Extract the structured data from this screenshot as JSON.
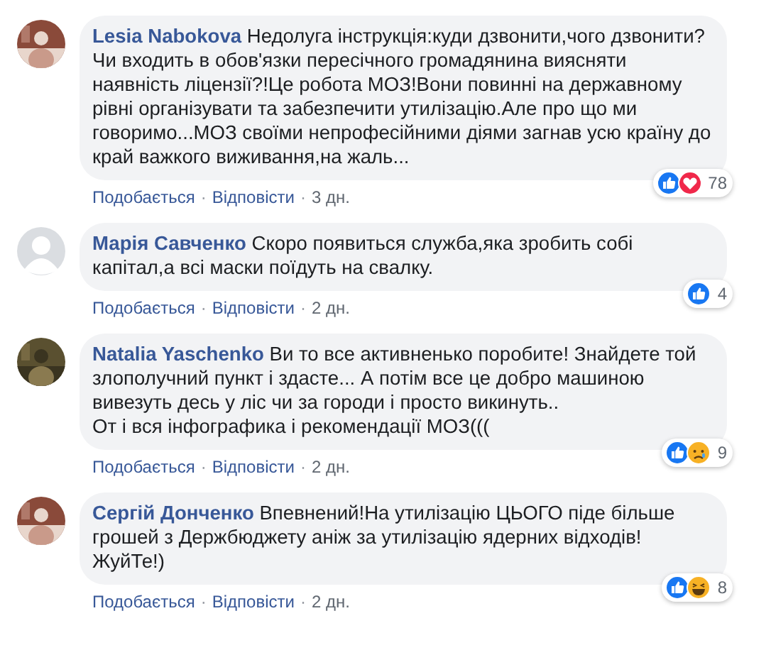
{
  "comments": [
    {
      "author": "Lesia Nabokova",
      "avatar": {
        "kind": "picture"
      },
      "text": "Недолуга інструкція:куди дзвонити,чого дзвонити?Чи входить в обов'язки пересічного громадянина виясняти наявність ліцензії?!Це робота МОЗ!Вони повинні на державному рівні організувати та забезпечити утилізацію.Але про що ми говоримо...МОЗ своїми непрофесійними діями загнав усю країну до край важкого виживання,на жаль...",
      "reactions": [
        {
          "kind": "like"
        },
        {
          "kind": "love"
        }
      ],
      "count": "78",
      "actions": [
        "Подобається",
        "Відповісти",
        "3 дн."
      ],
      "separator": "·"
    },
    {
      "author": "Марія Савченко",
      "avatar": {
        "kind": "default"
      },
      "text": "Скоро появиться служба,яка зробить собі капітал,а всі маски поїдуть на свалку.",
      "reactions": [
        {
          "kind": "like"
        }
      ],
      "count": "4",
      "actions": [
        "Подобається",
        "Відповісти",
        "2 дн."
      ],
      "separator": "·"
    },
    {
      "author": "Natalia Yaschenko",
      "avatar": {
        "kind": "picture"
      },
      "text": "Ви то все активненько поробите! Знайдете той злополучний пункт і здасте... А потім все це добро машиною вивезуть десь у ліс чи за городи і просто викинуть..\nОт і вся інфографика і рекомендації МОЗ(((",
      "reactions": [
        {
          "kind": "like"
        },
        {
          "kind": "sad"
        }
      ],
      "count": "9",
      "actions": [
        "Подобається",
        "Відповісти",
        "2 дн."
      ],
      "separator": "·"
    },
    {
      "author": "Сергій Донченко",
      "avatar": {
        "kind": "picture"
      },
      "text": "Впевнений!На утилізацію ЦЬОГО піде більше грошей з Держбюджету аніж за утилізацію ядерних відходів! ЖуйТе!)",
      "reactions": [
        {
          "kind": "like"
        },
        {
          "kind": "haha"
        }
      ],
      "count": "8",
      "actions": [
        "Подобається",
        "Відповісти",
        "2 дн."
      ],
      "separator": "·"
    }
  ]
}
